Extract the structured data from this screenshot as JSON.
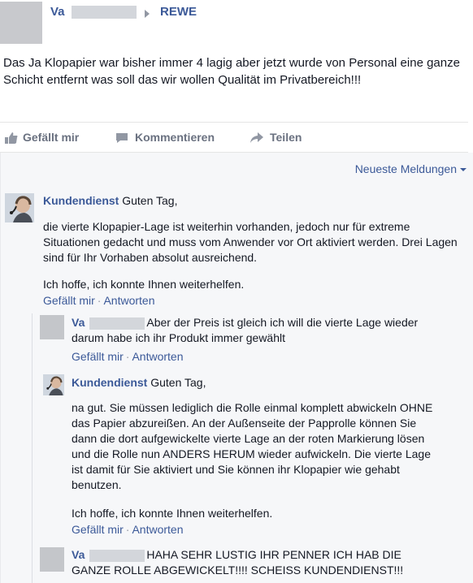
{
  "post": {
    "author_prefix": "Va",
    "target": "REWE",
    "text": "Das Ja Klopapier war bisher immer 4 lagig aber jetzt wurde von Personal eine ganze Schicht entfernt was soll das wir wollen Qualität im Privatbereich!!!",
    "actions": {
      "like": "Gefällt mir",
      "comment": "Kommentieren",
      "share": "Teilen"
    }
  },
  "comments": {
    "sort_label": "Neueste Meldungen",
    "items": [
      {
        "author": "Kundendienst",
        "greeting": "Guten Tag,",
        "paragraph1": "die vierte Klopapier-Lage ist weiterhin vorhanden, jedoch nur für extreme Situationen gedacht und muss vom Anwender vor Ort aktiviert werden. Drei Lagen sind für Ihr Vorhaben absolut ausreichend.",
        "paragraph2": "Ich hoffe, ich konnte Ihnen weiterhelfen.",
        "like": "Gefällt mir",
        "reply": "Antworten"
      }
    ],
    "replies": [
      {
        "author_prefix": "Va",
        "text": "Aber der Preis ist gleich ich will die vierte Lage wieder darum habe ich ihr Produkt immer gewählt",
        "like": "Gefällt mir",
        "reply": "Antworten"
      },
      {
        "author": "Kundendienst",
        "greeting": "Guten Tag,",
        "paragraph1": "na gut. Sie müssen lediglich die Rolle einmal komplett abwickeln OHNE das Papier abzureißen. An der Außenseite der Papprolle können Sie dann die dort aufgewickelte vierte Lage an der roten Markierung lösen und die Rolle nun ANDERS HERUM wieder aufwickeln. Die vierte Lage ist damit für Sie aktiviert und Sie können ihr Klopapier wie gehabt benutzen.",
        "paragraph2": "Ich hoffe, ich konnte Ihnen weiterhelfen.",
        "like": "Gefällt mir",
        "reply": "Antworten"
      },
      {
        "author_prefix": "Va",
        "text": "HAHA SEHR LUSTIG IHR PENNER ICH HAB DIE GANZE ROLLE ABGEWICKELT!!!! SCHEISS KUNDENDIENST!!!"
      }
    ]
  },
  "colors": {
    "link": "#3b5998",
    "muted": "#6a7180",
    "background_comments": "#f6f7f9"
  },
  "icons": {
    "like": "thumbs-up-icon",
    "comment": "speech-bubble-icon",
    "share": "share-arrow-icon",
    "sort": "caret-down-icon"
  }
}
